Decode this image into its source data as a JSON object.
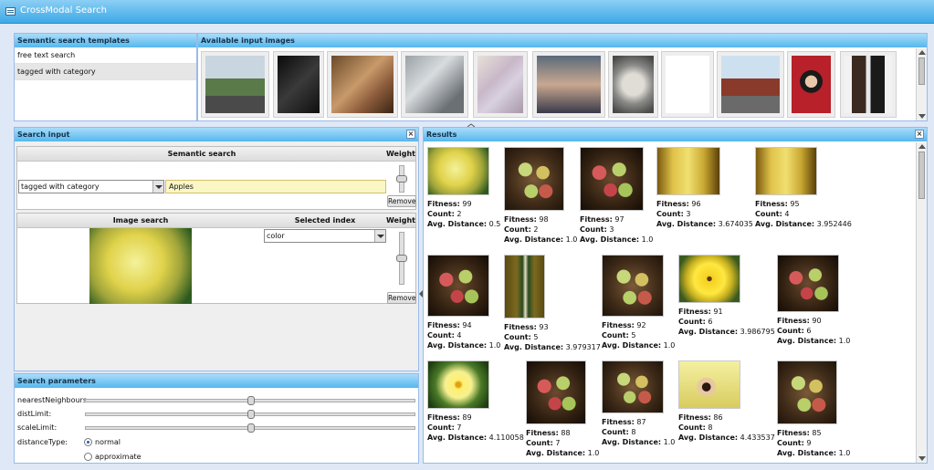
{
  "window": {
    "title": "CrossModal Search"
  },
  "templates": {
    "header": "Semantic search templates",
    "items": [
      "free text search",
      "tagged with category"
    ],
    "selected_index": 1
  },
  "available_images": {
    "header": "Available input images",
    "items": [
      "road",
      "dark-room",
      "people-on-bed",
      "rocky-landscape",
      "graffiti-wall",
      "people-indoors",
      "horse-statue",
      "nutrition-label",
      "temple-gate",
      "girl-red-coat",
      "couple-portrait"
    ]
  },
  "search_input": {
    "header": "Search input",
    "semantic": {
      "title": "Semantic search",
      "weight_label": "Weight",
      "weight": 0.5,
      "category_select": "tagged with category",
      "text_value": "Apples",
      "remove_label": "Remove"
    },
    "image": {
      "title": "Image search",
      "index_title": "Selected index",
      "weight_label": "Weight",
      "weight": 0.5,
      "index_select": "color",
      "remove_label": "Remove"
    }
  },
  "search_params": {
    "header": "Search parameters",
    "rows": [
      {
        "label": "nearestNeighbours:",
        "value": 0.5
      },
      {
        "label": "distLimit:",
        "value": 0.5
      },
      {
        "label": "scaleLimit:",
        "value": 0.5
      }
    ],
    "distance_type_label": "distanceType:",
    "distance_options": [
      "normal",
      "approximate"
    ],
    "distance_selected": "normal"
  },
  "results": {
    "header": "Results",
    "items": [
      {
        "fitness": "Fitness: 99",
        "count": "Count: 2",
        "dist": "Avg. Distance: 0.5",
        "img": "apple-yellow"
      },
      {
        "fitness": "Fitness: 98",
        "count": "Count: 2",
        "dist": "Avg. Distance: 1.0",
        "img": "apple-bowl"
      },
      {
        "fitness": "Fitness: 97",
        "count": "Count: 3",
        "dist": "Avg. Distance: 1.0",
        "img": "apple-red"
      },
      {
        "fitness": "Fitness: 96",
        "count": "Count: 3",
        "dist": "Avg. Distance: 3.674035",
        "img": "hallway"
      },
      {
        "fitness": "Fitness: 95",
        "count": "Count: 4",
        "dist": "Avg. Distance: 3.952446",
        "img": "hallway"
      },
      {
        "fitness": "Fitness: 94",
        "count": "Count: 4",
        "dist": "Avg. Distance: 1.0",
        "img": "apple-red"
      },
      {
        "fitness": "Fitness: 93",
        "count": "Count: 5",
        "dist": "Avg. Distance: 3.979317",
        "img": "bottle"
      },
      {
        "fitness": "Fitness: 92",
        "count": "Count: 5",
        "dist": "Avg. Distance: 1.0",
        "img": "apple-bowl"
      },
      {
        "fitness": "Fitness: 91",
        "count": "Count: 6",
        "dist": "Avg. Distance: 3.986795",
        "img": "flower"
      },
      {
        "fitness": "Fitness: 90",
        "count": "Count: 6",
        "dist": "Avg. Distance: 1.0",
        "img": "apple-red"
      },
      {
        "fitness": "Fitness: 89",
        "count": "Count: 7",
        "dist": "Avg. Distance: 4.110058",
        "img": "lily"
      },
      {
        "fitness": "Fitness: 88",
        "count": "Count: 7",
        "dist": "Avg. Distance: 1.0",
        "img": "apple-red"
      },
      {
        "fitness": "Fitness: 87",
        "count": "Count: 8",
        "dist": "Avg. Distance: 1.0",
        "img": "apple-bowl"
      },
      {
        "fitness": "Fitness: 86",
        "count": "Count: 8",
        "dist": "Avg. Distance: 4.433537",
        "img": "girl"
      },
      {
        "fitness": "Fitness: 85",
        "count": "Count: 9",
        "dist": "Avg. Distance: 1.0",
        "img": "apple-bowl"
      }
    ]
  }
}
